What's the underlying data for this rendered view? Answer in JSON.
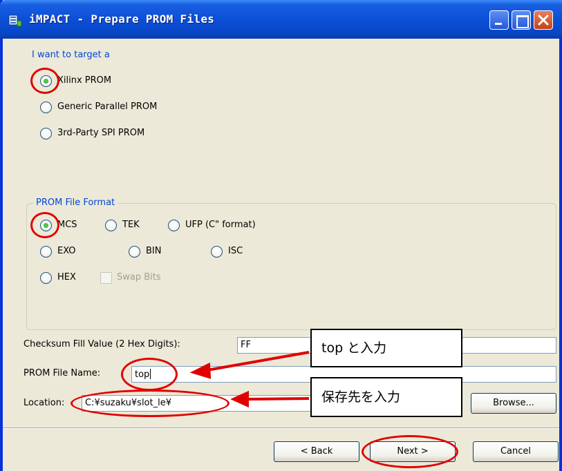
{
  "window": {
    "title": "iMPACT - Prepare PROM Files"
  },
  "target": {
    "heading": "I want to target a",
    "options": [
      "Xilinx PROM",
      "Generic Parallel PROM",
      "3rd-Party SPI PROM"
    ],
    "selected": "Xilinx PROM"
  },
  "format": {
    "group_title": "PROM File Format",
    "options": [
      "MCS",
      "TEK",
      "UFP (C\" format)",
      "EXO",
      "BIN",
      "ISC",
      "HEX"
    ],
    "selected": "MCS",
    "swap_bits_label": "Swap Bits",
    "swap_bits_checked": false
  },
  "fields": {
    "checksum_label": "Checksum Fill Value (2 Hex Digits):",
    "checksum_value": "FF",
    "filename_label": "PROM File Name:",
    "filename_value": "top",
    "location_label": "Location:",
    "location_value": "C:¥suzaku¥slot_le¥"
  },
  "buttons": {
    "browse": "Browse...",
    "back": "< Back",
    "next": "Next >",
    "cancel": "Cancel"
  },
  "annotations": {
    "callout_top": "top と入力",
    "callout_location": "保存先を入力",
    "highlight_color": "#e00000"
  }
}
